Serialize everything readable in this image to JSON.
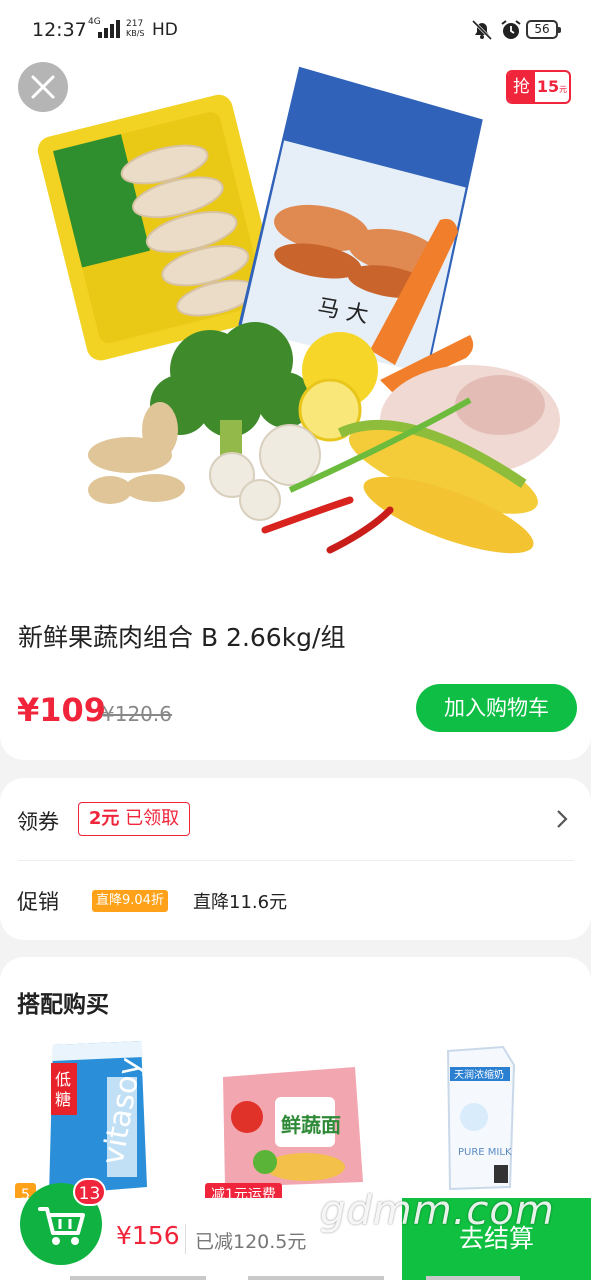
{
  "status_bar": {
    "time": "12:37",
    "network": "4G",
    "speed_value": "217",
    "speed_unit": "KB/S",
    "hd": "HD",
    "battery": "56",
    "icons": [
      "mute-icon",
      "alarm-icon",
      "battery-icon"
    ]
  },
  "hero": {
    "close_icon": "close-icon",
    "flash_badge": {
      "left": "抢",
      "amount": "15",
      "unit": "元"
    }
  },
  "product": {
    "title": "新鲜果蔬肉组合 B 2.66kg/组",
    "price": "¥109",
    "original_price": "¥120.6",
    "add_to_cart": "加入购物车"
  },
  "coupon": {
    "label": "领券",
    "amount": "2元",
    "status": "已领取"
  },
  "promotion": {
    "label": "促销",
    "tag": "直降9.04折",
    "text": "直降11.6元"
  },
  "bundle": {
    "title": "搭配购买",
    "items": [
      {
        "name": "vitasoy-lowsugar-soymilk",
        "tag": "5",
        "tag_color": "#ffa21a"
      },
      {
        "name": "master-kong-veggie-noodle",
        "tag": "减1元运费",
        "tag_color": "#f0243a"
      },
      {
        "name": "pure-milk",
        "tag": "",
        "tag_color": ""
      }
    ]
  },
  "cart": {
    "count": "13",
    "total": "¥156",
    "saved": "已减120.5元",
    "checkout": "去结算"
  },
  "watermark": "gdmm.com",
  "colors": {
    "brand_green": "#10b341",
    "price_red": "#f0243a",
    "promo_orange": "#ffa21a"
  }
}
